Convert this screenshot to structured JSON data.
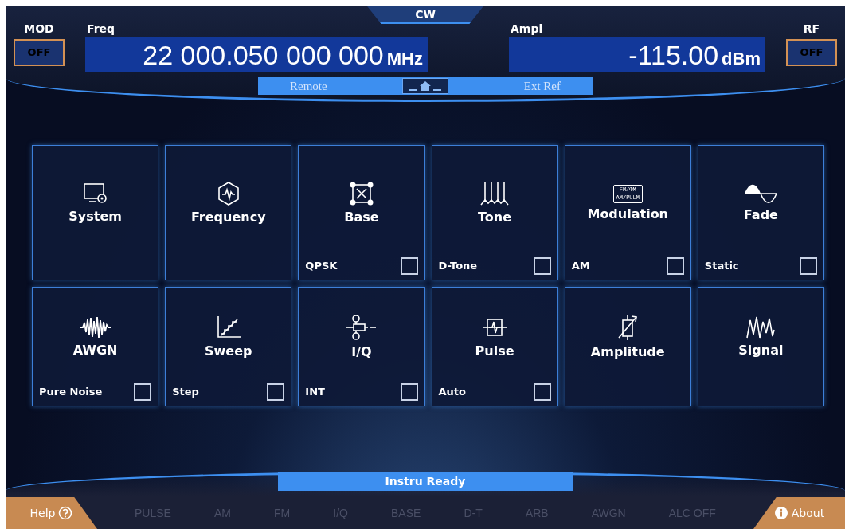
{
  "header": {
    "mode": "CW",
    "mod": {
      "label": "MOD",
      "value": "OFF"
    },
    "freq": {
      "label": "Freq",
      "value": "22 000.050 000 000",
      "unit": "MHz"
    },
    "ampl": {
      "label": "Ampl",
      "value": "-115.00",
      "unit": "dBm"
    },
    "rf": {
      "label": "RF",
      "value": "OFF"
    },
    "indicators": [
      {
        "label": "Remote",
        "active": false
      },
      {
        "label": "Ext Ref",
        "active": false
      }
    ]
  },
  "tiles": [
    {
      "title": "System",
      "kind": "system"
    },
    {
      "title": "Frequency",
      "kind": "frequency"
    },
    {
      "title": "Base",
      "kind": "base",
      "option": "QPSK",
      "checked": false
    },
    {
      "title": "Tone",
      "kind": "tone",
      "option": "D-Tone",
      "checked": false
    },
    {
      "title": "Modulation",
      "kind": "modulation",
      "icon_text": [
        "FM/ΦM",
        "AM/PULM"
      ],
      "option": "AM",
      "checked": false
    },
    {
      "title": "Fade",
      "kind": "fade",
      "option": "Static",
      "checked": false
    },
    {
      "title": "AWGN",
      "kind": "awgn",
      "option": "Pure Noise",
      "checked": false
    },
    {
      "title": "Sweep",
      "kind": "sweep",
      "option": "Step",
      "checked": false
    },
    {
      "title": "I/Q",
      "kind": "iq",
      "option": "INT",
      "checked": false
    },
    {
      "title": "Pulse",
      "kind": "pulse",
      "option": "Auto",
      "checked": false
    },
    {
      "title": "Amplitude",
      "kind": "amplitude"
    },
    {
      "title": "Signal",
      "kind": "signal"
    }
  ],
  "status": {
    "message": "Instru Ready",
    "help": "Help",
    "about": "About",
    "indicators": [
      {
        "label": "PULSE",
        "active": false
      },
      {
        "label": "AM",
        "active": false
      },
      {
        "label": "FM",
        "active": false
      },
      {
        "label": "I/Q",
        "active": false
      },
      {
        "label": "BASE",
        "active": false
      },
      {
        "label": "D-T",
        "active": false
      },
      {
        "label": "ARB",
        "active": false
      },
      {
        "label": "AWGN",
        "active": false
      },
      {
        "label": "ALC OFF",
        "active": false
      }
    ]
  }
}
